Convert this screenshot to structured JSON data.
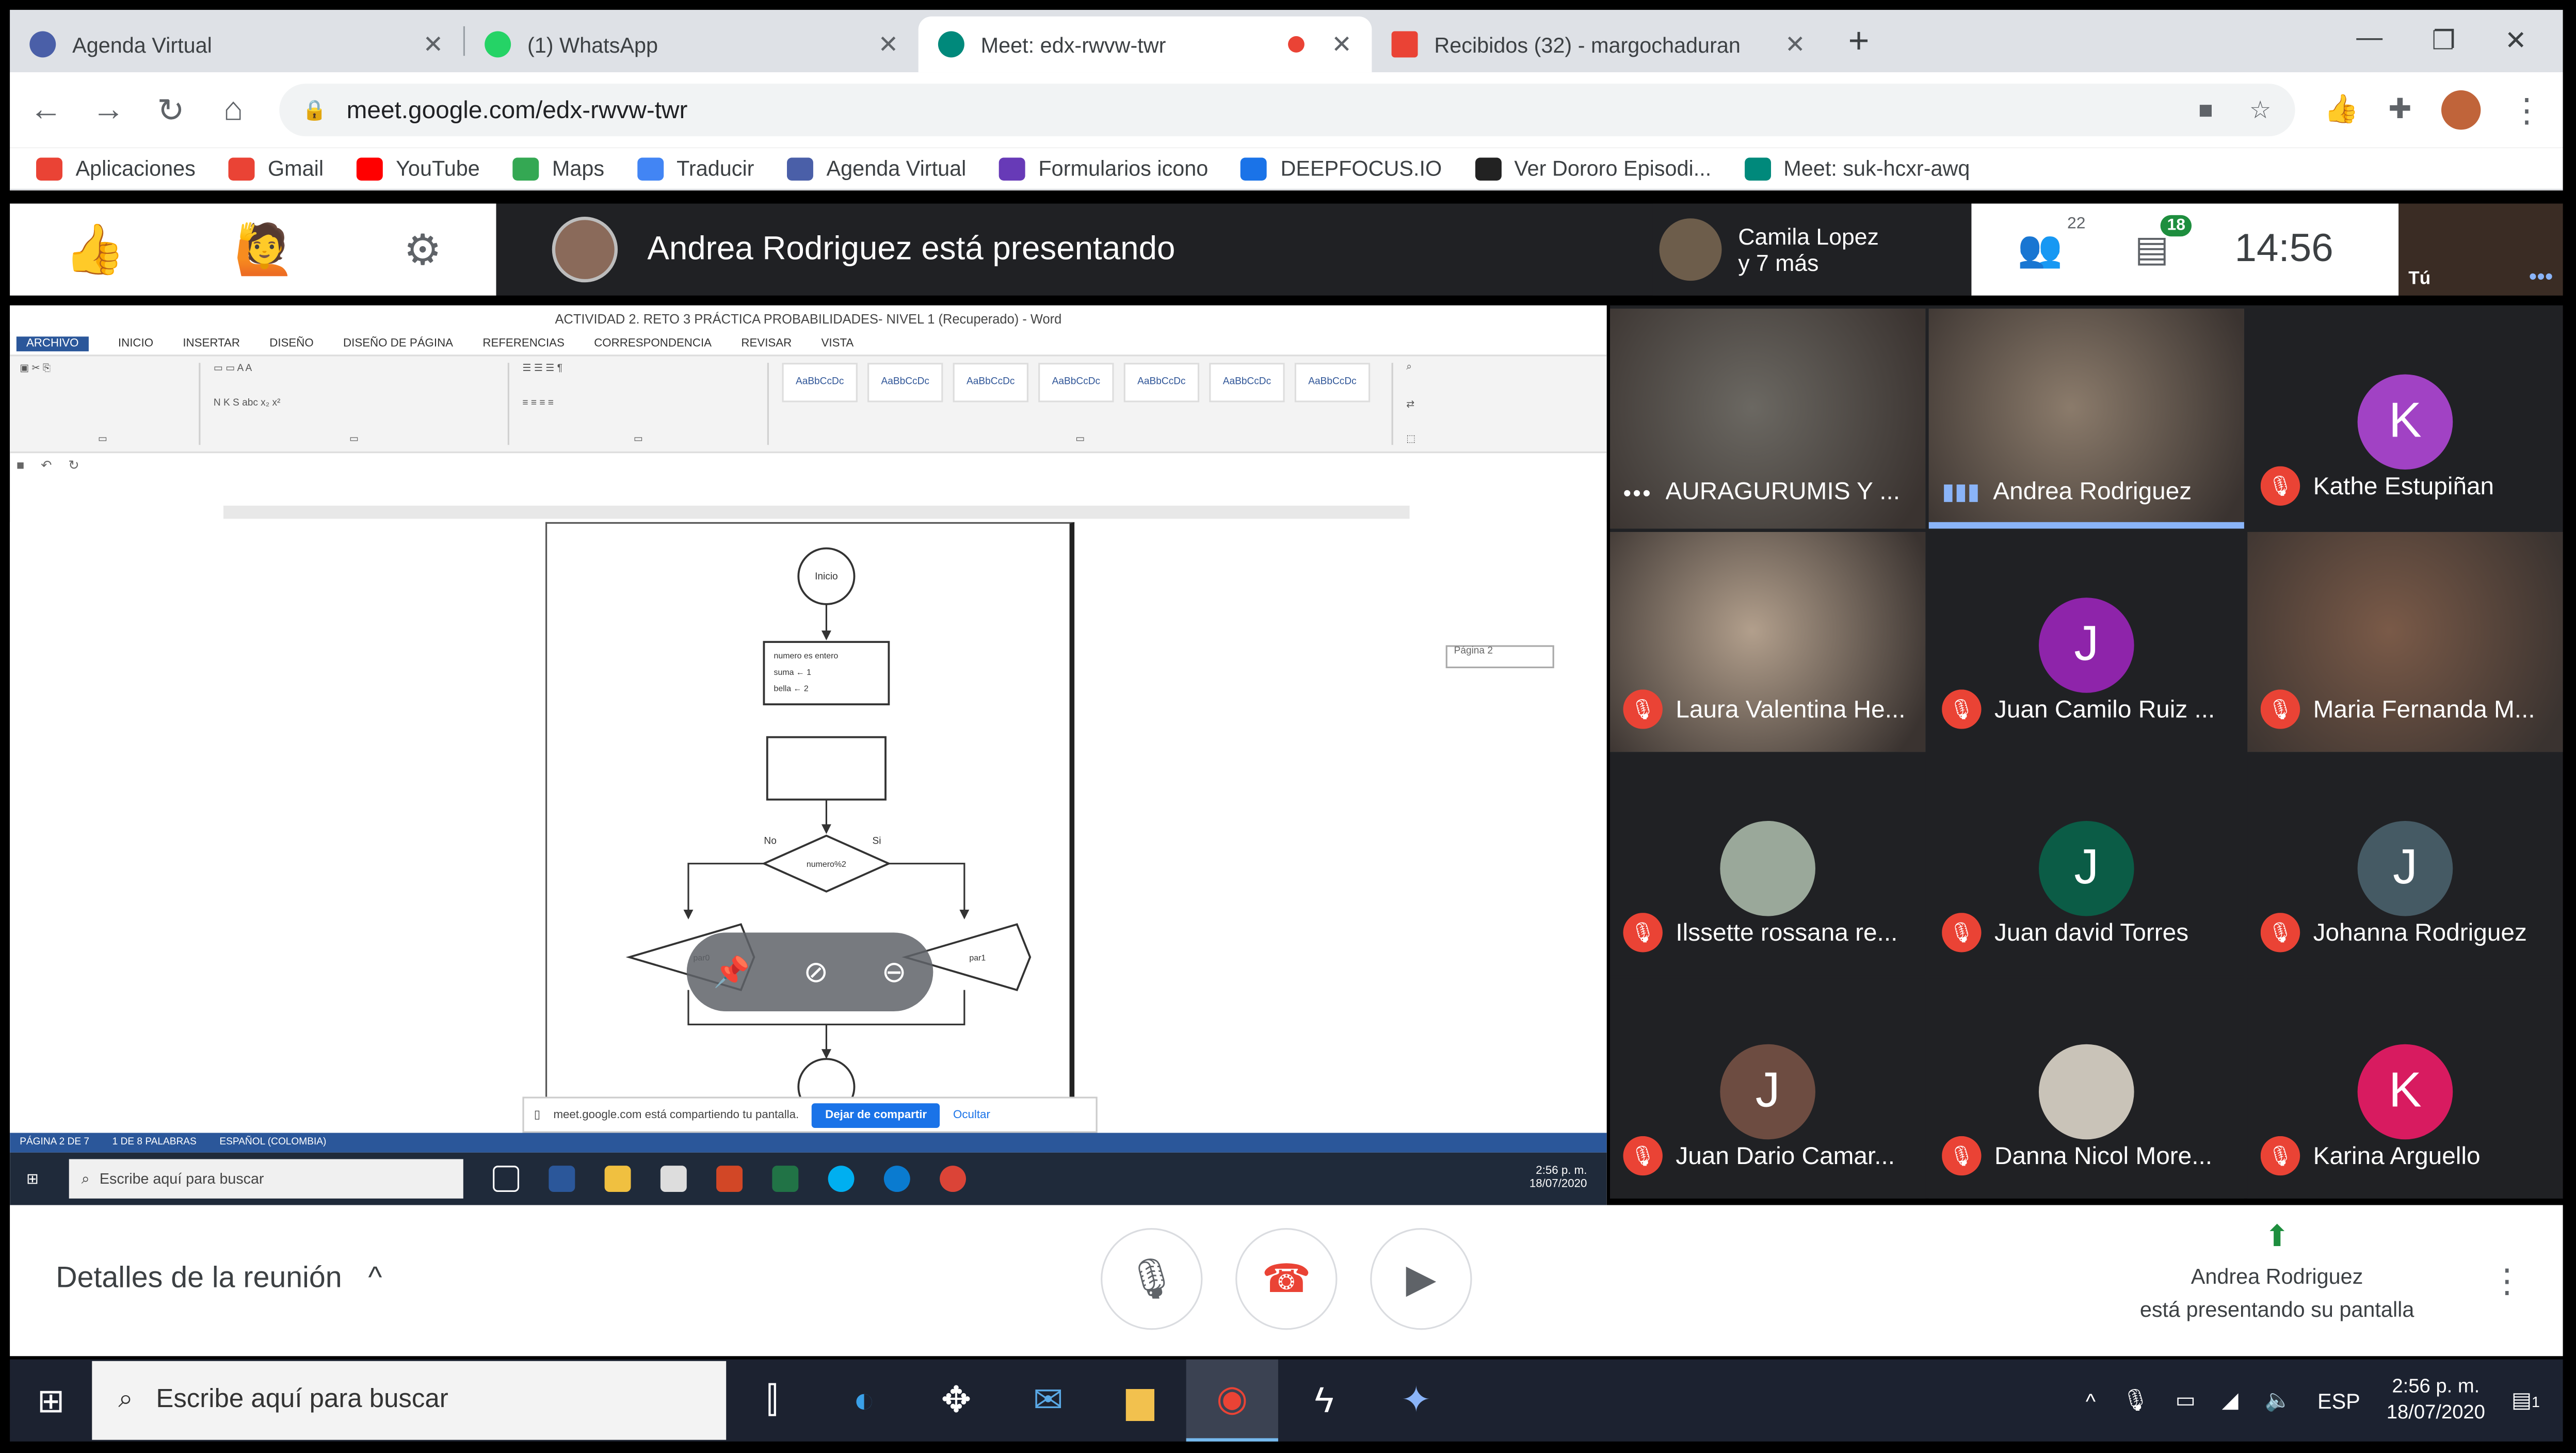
{
  "browser": {
    "tabs": [
      {
        "title": "Agenda Virtual",
        "icon": "agenda-icon",
        "color": "#4a5fa8",
        "active": false
      },
      {
        "title": "(1) WhatsApp",
        "icon": "whatsapp-icon",
        "color": "#25d366",
        "active": false
      },
      {
        "title": "Meet: edx-rwvw-twr",
        "icon": "meet-icon",
        "color": "#00897b",
        "active": true
      },
      {
        "title": "Recibidos (32) - margochaduran",
        "icon": "gmail-icon",
        "color": "#ea4335",
        "active": false
      }
    ],
    "url": "meet.google.com/edx-rwvw-twr",
    "bookmarks": [
      {
        "label": "Aplicaciones",
        "color": "#ea4335"
      },
      {
        "label": "Gmail",
        "color": "#ea4335"
      },
      {
        "label": "YouTube",
        "color": "#ff0000"
      },
      {
        "label": "Maps",
        "color": "#34a853"
      },
      {
        "label": "Traducir",
        "color": "#4285f4"
      },
      {
        "label": "Agenda Virtual",
        "color": "#4a5fa8"
      },
      {
        "label": "Formularios icono",
        "color": "#673ab7"
      },
      {
        "label": "DEEPFOCUS.IO",
        "color": "#1a73e8"
      },
      {
        "label": "Ver Dororo Episodi...",
        "color": "#222222"
      },
      {
        "label": "Meet: suk-hcxr-awq",
        "color": "#00897b"
      }
    ]
  },
  "meet": {
    "presenting_text": "Andrea Rodriguez está presentando",
    "others_line1": "Camila Lopez",
    "others_line2": "y 7 más",
    "participants_count": "22",
    "chat_count": "18",
    "clock": "14:56",
    "self_label": "Tú",
    "details_label": "Detalles de la reunión",
    "present_name": "Andrea Rodriguez",
    "present_line2": "está presentando su pantalla",
    "tiles": [
      {
        "name": "AURAGURUMIS Y ...",
        "type": "video",
        "status": "more",
        "bg": "#6b6862"
      },
      {
        "name": "Andrea Rodriguez",
        "type": "video",
        "status": "speaking",
        "bg": "#8b7b6b"
      },
      {
        "name": "Kathe Estupiñan",
        "type": "letter",
        "letter": "K",
        "status": "muted",
        "bg": "#a142c4"
      },
      {
        "name": "Laura Valentina He...",
        "type": "video",
        "status": "muted",
        "bg": "#b29f8c"
      },
      {
        "name": "Juan Camilo Ruiz ...",
        "type": "letter",
        "letter": "J",
        "status": "muted",
        "bg": "#8e24aa"
      },
      {
        "name": "Maria Fernanda M...",
        "type": "video",
        "status": "muted",
        "bg": "#7a5a48"
      },
      {
        "name": "Ilssette rossana re...",
        "type": "photo",
        "status": "muted",
        "bg": "#9aa89a"
      },
      {
        "name": "Juan david Torres",
        "type": "letter",
        "letter": "J",
        "status": "muted",
        "bg": "#0b5c46"
      },
      {
        "name": "Johanna Rodriguez",
        "type": "letter",
        "letter": "J",
        "status": "muted",
        "bg": "#455a64"
      },
      {
        "name": "Juan Dario Camar...",
        "type": "letter",
        "letter": "J",
        "status": "muted",
        "bg": "#6d4c41"
      },
      {
        "name": "Danna Nicol More...",
        "type": "photo",
        "status": "muted",
        "bg": "#c9c3b8"
      },
      {
        "name": "Karina Arguello",
        "type": "letter",
        "letter": "K",
        "status": "muted",
        "bg": "#d81b60"
      }
    ]
  },
  "word": {
    "title": "ACTIVIDAD 2. RETO 3 PRÁCTICA PROBABILIDADES- NIVEL 1 (Recuperado) - Word",
    "tabs": [
      "ARCHIVO",
      "INICIO",
      "INSERTAR",
      "DISEÑO",
      "DISEÑO DE PÁGINA",
      "REFERENCIAS",
      "CORRESPONDENCIA",
      "REVISAR",
      "VISTA"
    ],
    "page_tip": "Página 2",
    "flow_start": "Inicio",
    "flow_decl": [
      "numero   es   entero",
      "suma   ←   1",
      "bella   ←   2"
    ],
    "flow_decision": "numero%2",
    "flow_no": "No",
    "flow_yes": "Si",
    "flow_left": "par0",
    "flow_right": "par1",
    "share_text": "meet.google.com está compartiendo tu pantalla.",
    "share_stop": "Dejar de compartir",
    "share_hide": "Ocultar",
    "status_text": "PÁGINA 2 DE 7",
    "status_words": "1 DE 8 PALABRAS",
    "status_lang": "ESPAÑOL (COLOMBIA)",
    "inner_search": "Escribe aquí para buscar",
    "inner_time": "2:56 p. m.",
    "inner_date": "18/07/2020"
  },
  "taskbar": {
    "search_placeholder": "Escribe aquí para buscar",
    "lang": "ESP",
    "time": "2:56 p. m.",
    "date": "18/07/2020",
    "notifications": "1"
  }
}
